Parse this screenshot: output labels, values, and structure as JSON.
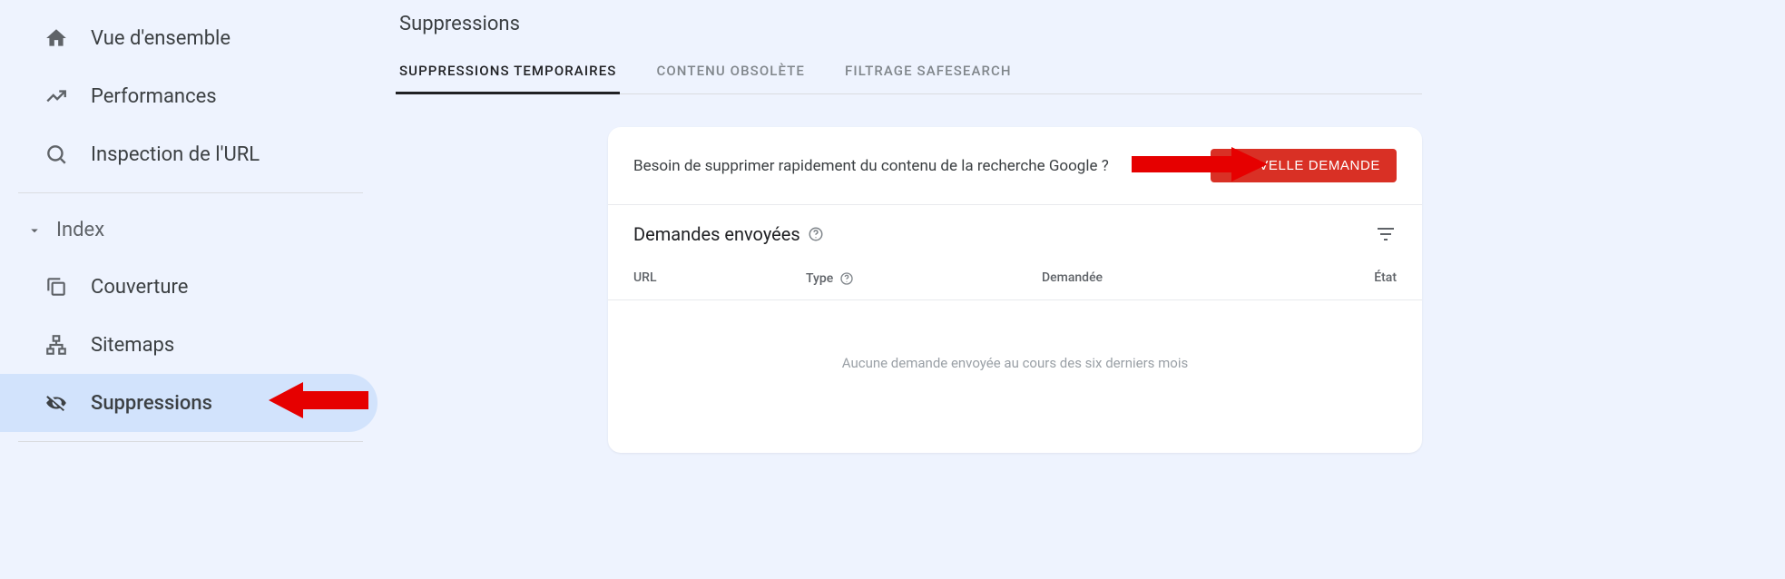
{
  "sidebar": {
    "items": [
      {
        "label": "Vue d'ensemble"
      },
      {
        "label": "Performances"
      },
      {
        "label": "Inspection de l'URL"
      }
    ],
    "section_label": "Index",
    "index_items": [
      {
        "label": "Couverture"
      },
      {
        "label": "Sitemaps"
      },
      {
        "label": "Suppressions"
      }
    ]
  },
  "page": {
    "title": "Suppressions"
  },
  "tabs": [
    {
      "label": "Suppressions temporaires"
    },
    {
      "label": "Contenu obsolète"
    },
    {
      "label": "Filtrage SafeSearch"
    }
  ],
  "card": {
    "prompt": "Besoin de supprimer rapidement du contenu de la recherche Google ?",
    "new_request_label": "NOUVELLE DEMANDE",
    "subtitle": "Demandes envoyées",
    "columns": {
      "url": "URL",
      "type": "Type",
      "date": "Demandée",
      "state": "État"
    },
    "empty": "Aucune demande envoyée au cours des six derniers mois"
  }
}
